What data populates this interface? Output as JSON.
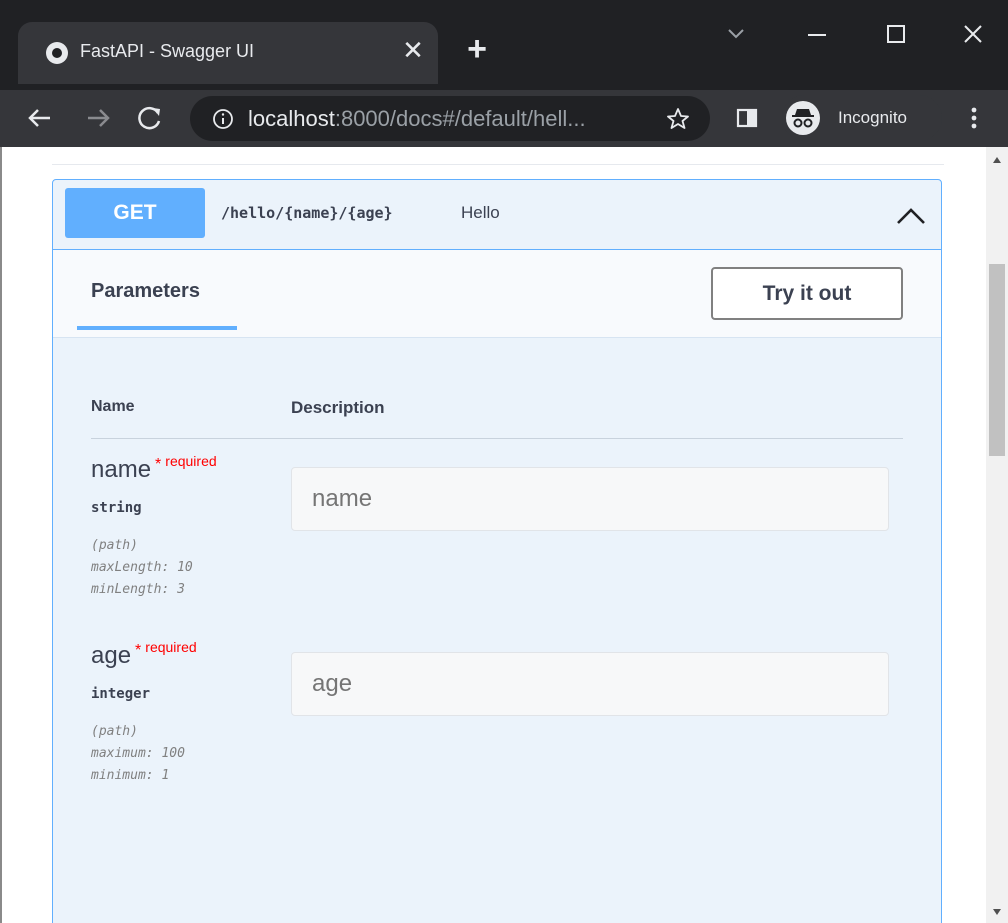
{
  "browser": {
    "tab_title": "FastAPI - Swagger UI",
    "tab_close": "✕",
    "new_tab": "+",
    "url_host": "localhost",
    "url_rest": ":8000/docs#/default/hell...",
    "incognito_label": "Incognito"
  },
  "operation": {
    "method": "GET",
    "path": "/hello/{name}/{age}",
    "summary": "Hello",
    "tab_label": "Parameters",
    "try_label": "Try it out",
    "col_name": "Name",
    "col_description": "Description"
  },
  "parameters": [
    {
      "name": "name",
      "star": "*",
      "required": "required",
      "type": "string",
      "in": "(path)",
      "constraints": [
        "maxLength: 10",
        "minLength: 3"
      ],
      "placeholder": "name"
    },
    {
      "name": "age",
      "star": "*",
      "required": "required",
      "type": "integer",
      "in": "(path)",
      "constraints": [
        "maximum: 100",
        "minimum: 1"
      ],
      "placeholder": "age"
    }
  ],
  "colors": {
    "get_method": "#61affe",
    "opblock_bg": "#ebf3fb",
    "required": "#ff0000",
    "chrome_dark": "#202124",
    "chrome_toolbar": "#35363a"
  },
  "icons": [
    "favicon-icon",
    "close-icon",
    "plus-icon",
    "chevron-down-icon",
    "minimize-icon",
    "maximize-icon",
    "window-close-icon",
    "back-icon",
    "forward-icon",
    "reload-icon",
    "info-icon",
    "star-icon",
    "side-panel-icon",
    "incognito-icon",
    "kebab-menu-icon",
    "chevron-up-icon"
  ]
}
